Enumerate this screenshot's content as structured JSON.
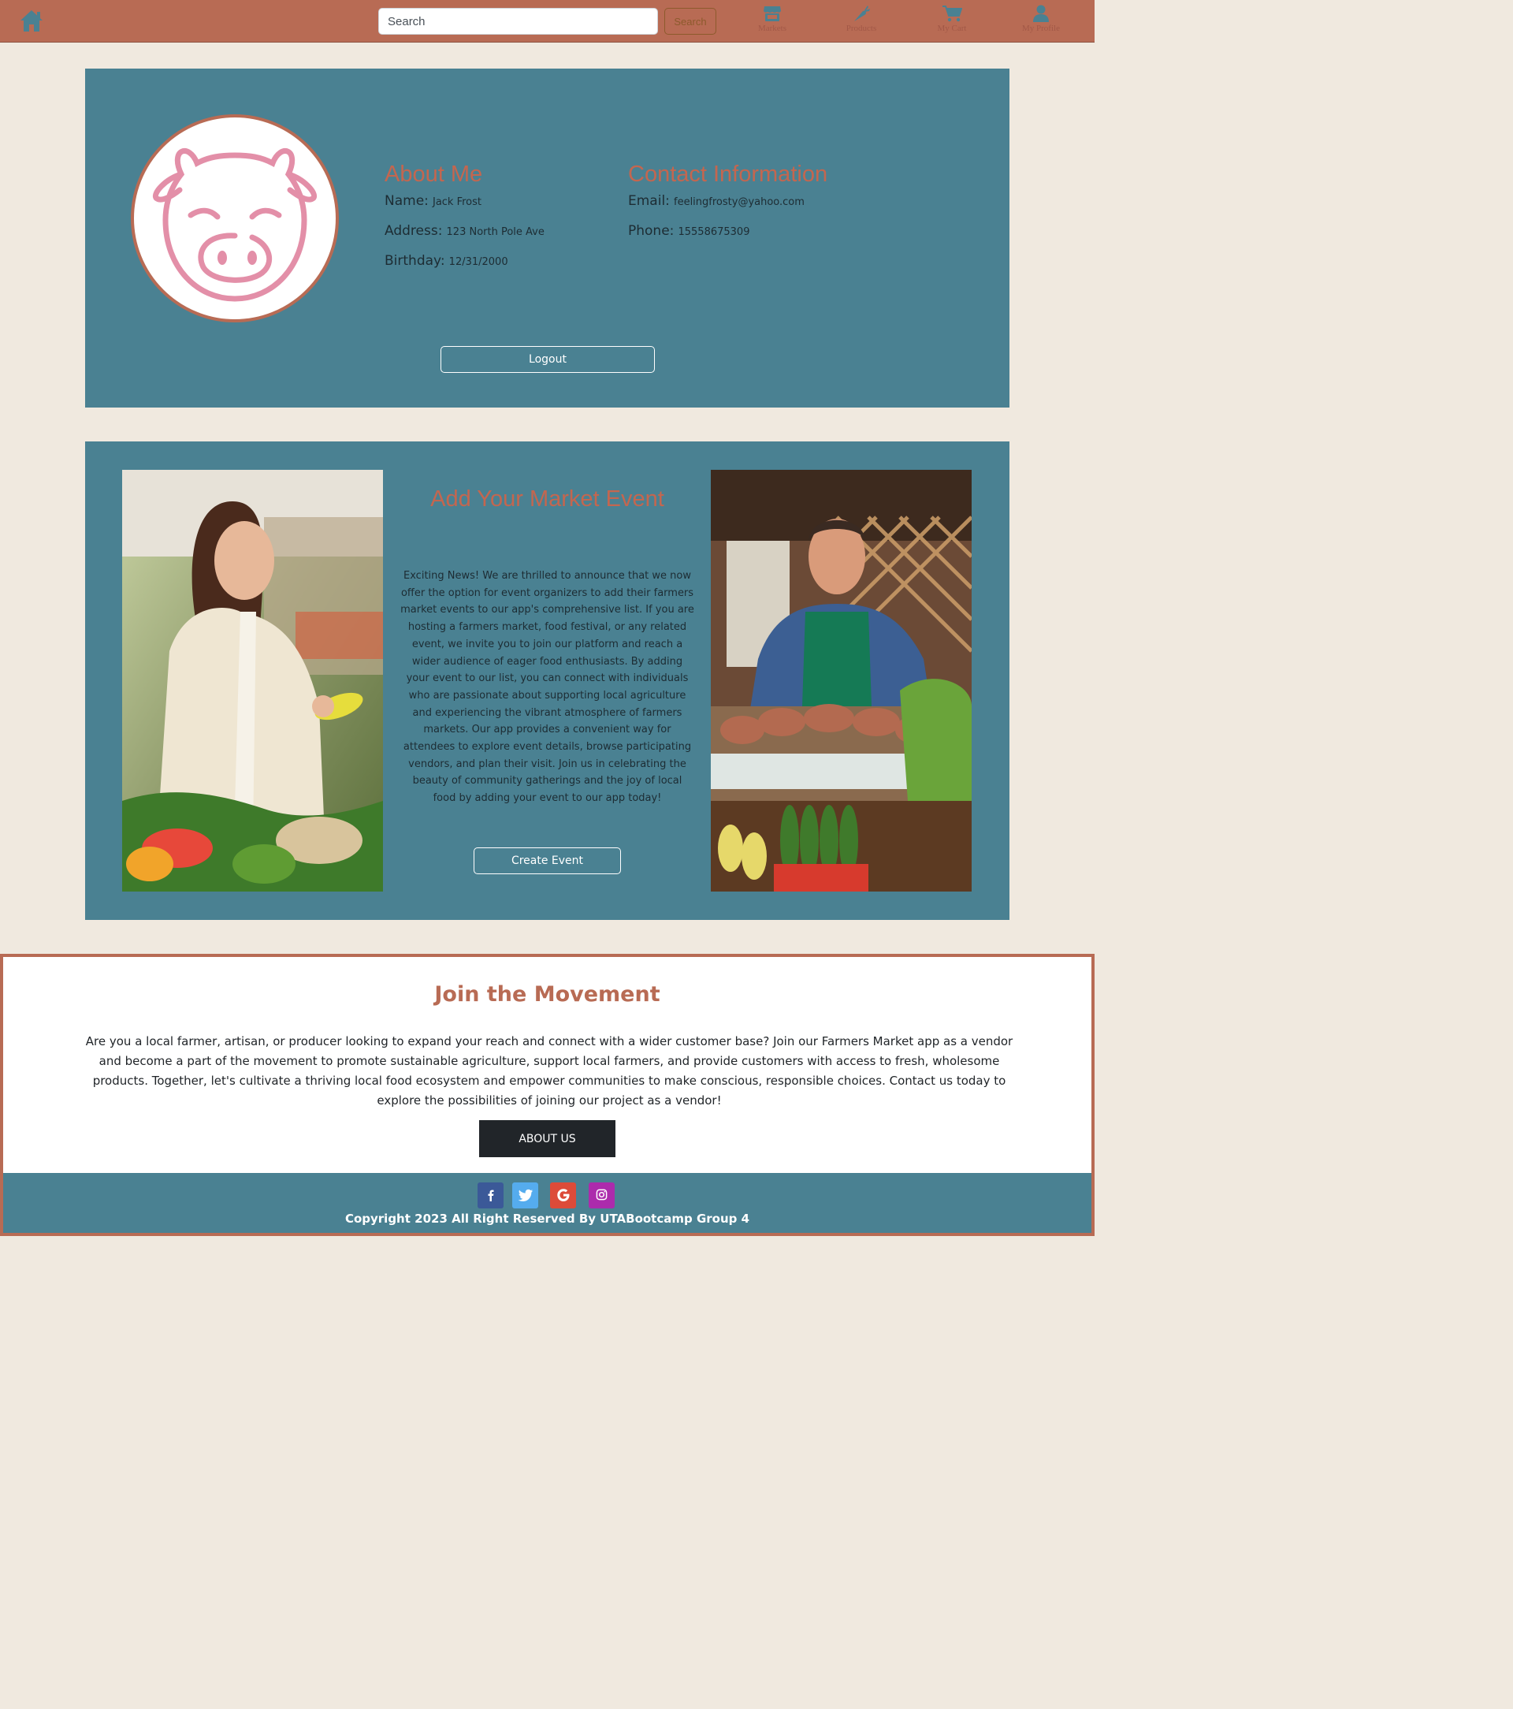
{
  "nav": {
    "search_placeholder": "Search",
    "search_button": "Search",
    "items": [
      {
        "label": "Markets",
        "icon": "store-icon"
      },
      {
        "label": "Products",
        "icon": "carrot-icon"
      },
      {
        "label": "My Cart",
        "icon": "cart-icon"
      },
      {
        "label": "My Profile",
        "icon": "user-icon"
      }
    ]
  },
  "profile": {
    "avatar_icon": "pig-icon",
    "about_heading": "About Me",
    "name_label": "Name:",
    "name": "Jack Frost",
    "address_label": "Address:",
    "address": "123 North Pole Ave",
    "birthday_label": "Birthday:",
    "birthday": "12/31/2000",
    "contact_heading": "Contact Information",
    "email_label": "Email:",
    "email": "feelingfrosty@yahoo.com",
    "phone_label": "Phone:",
    "phone": "15558675309",
    "logout_button": "Logout"
  },
  "event": {
    "title": "Add Your Market Event",
    "text": "Exciting News! We are thrilled to announce that we now offer the option for event organizers to add their farmers market events to our app's comprehensive list. If you are hosting a farmers market, food festival, or any related event, we invite you to join our platform and reach a wider audience of eager food enthusiasts. By adding your event to our list, you can connect with individuals who are passionate about supporting local agriculture and experiencing the vibrant atmosphere of farmers markets. Our app provides a convenient way for attendees to explore event details, browse participating vendors, and plan their visit. Join us in celebrating the beauty of community gatherings and the joy of local food by adding your event to our app today!",
    "create_button": "Create Event"
  },
  "join": {
    "title": "Join the Movement",
    "text": "Are you a local farmer, artisan, or producer looking to expand your reach and connect with a wider customer base? Join our Farmers Market app as a vendor and become a part of the movement to promote sustainable agriculture, support local farmers, and provide customers with access to fresh, wholesome products. Together, let's cultivate a thriving local food ecosystem and empower communities to make conscious, responsible choices. Contact us today to explore the possibilities of joining our project as a vendor!",
    "button": "ABOUT US"
  },
  "footer": {
    "social": [
      {
        "icon": "facebook-icon",
        "color": "#3b5998"
      },
      {
        "icon": "twitter-icon",
        "color": "#55acee"
      },
      {
        "icon": "google-icon",
        "color": "#dd4b39"
      },
      {
        "icon": "instagram-icon",
        "color": "#ac2bac"
      }
    ],
    "copyright": "Copyright 2023 All Right Reserved By UTABootcamp Group 4"
  },
  "colors": {
    "nav": "#b86b54",
    "accent_blue": "#4a8192",
    "page_bg": "#f0e9df",
    "heading_orange": "#c4664f"
  }
}
